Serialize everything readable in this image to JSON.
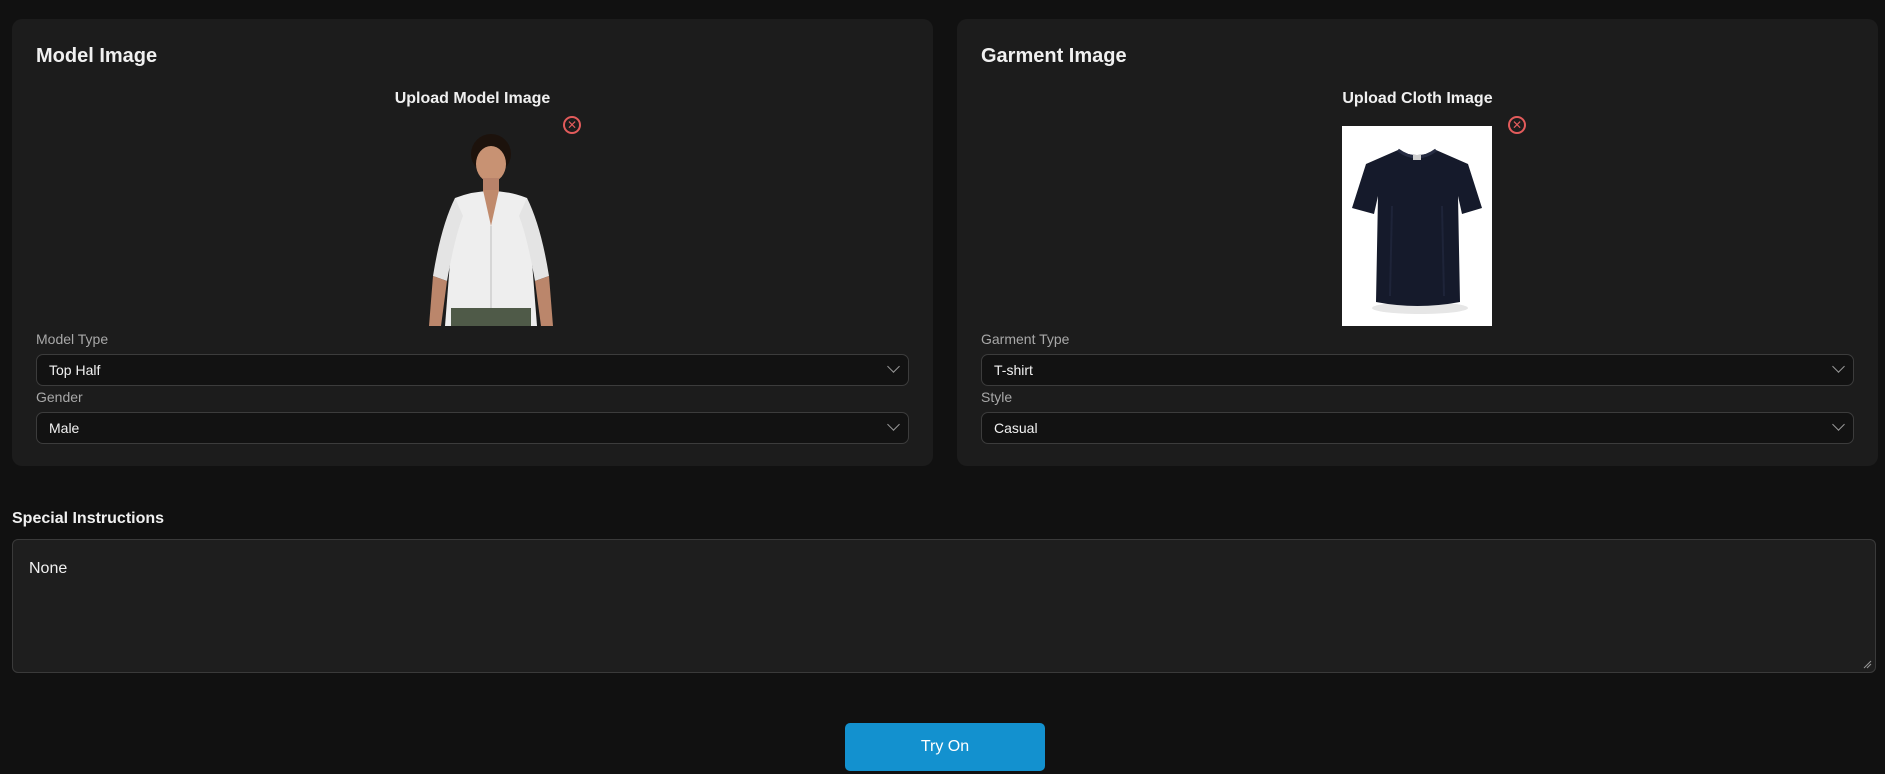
{
  "model_panel": {
    "title": "Model Image",
    "upload_label": "Upload Model Image",
    "remove_icon": "close-circle-icon",
    "model_type": {
      "label": "Model Type",
      "value": "Top Half"
    },
    "gender": {
      "label": "Gender",
      "value": "Male"
    }
  },
  "garment_panel": {
    "title": "Garment Image",
    "upload_label": "Upload Cloth Image",
    "remove_icon": "close-circle-icon",
    "garment_type": {
      "label": "Garment Type",
      "value": "T-shirt"
    },
    "style": {
      "label": "Style",
      "value": "Casual"
    }
  },
  "special_instructions": {
    "label": "Special Instructions",
    "value": "None"
  },
  "try_on_button": {
    "label": "Try On"
  },
  "colors": {
    "background": "#111111",
    "panel": "#1c1c1c",
    "accent": "#1391cf",
    "remove": "#e25b5b"
  }
}
